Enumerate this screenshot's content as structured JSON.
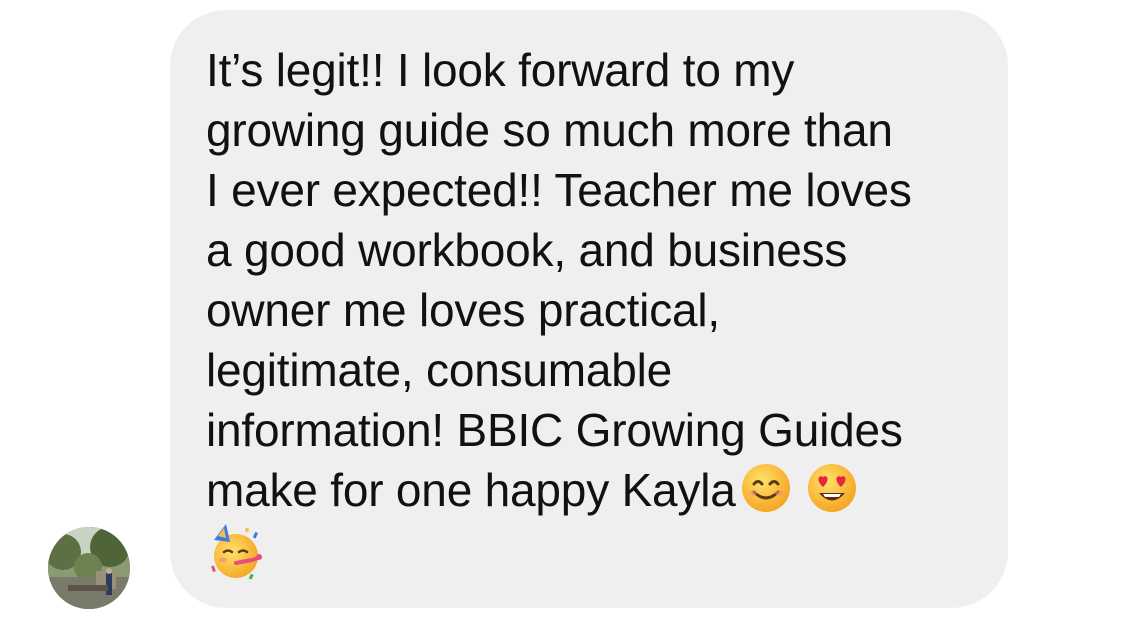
{
  "message": {
    "lines": [
      "It’s legit!! I look forward to my",
      "growing guide so much more than",
      "I ever expected!! Teacher me loves",
      "a good workbook, and business",
      "owner me loves practical,",
      "legitimate, consumable",
      "information! BBIC Growing Guides",
      "make for one happy Kayla"
    ],
    "emojis": [
      "smiling-face-emoji",
      "heart-eyes-emoji",
      "partying-face-emoji"
    ]
  },
  "colors": {
    "bubble": "#efefef",
    "text": "#111111",
    "background": "#ffffff"
  }
}
